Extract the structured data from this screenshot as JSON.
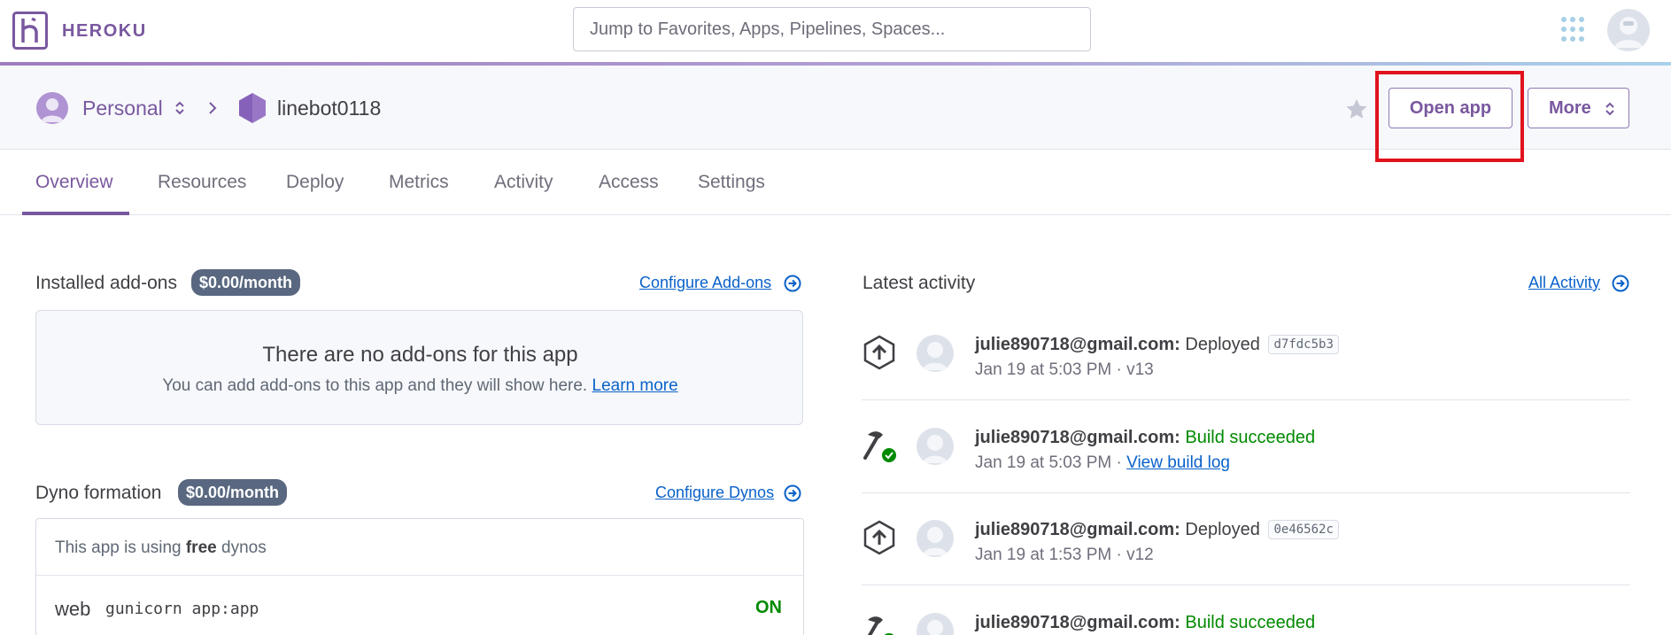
{
  "topbar": {
    "logo_text": "HEROKU",
    "search_placeholder": "Jump to Favorites, Apps, Pipelines, Spaces..."
  },
  "header": {
    "account_label": "Personal",
    "app_name": "linebot0118",
    "open_app_label": "Open app",
    "more_label": "More"
  },
  "tabs": [
    {
      "label": "Overview",
      "active": true
    },
    {
      "label": "Resources"
    },
    {
      "label": "Deploy"
    },
    {
      "label": "Metrics"
    },
    {
      "label": "Activity"
    },
    {
      "label": "Access"
    },
    {
      "label": "Settings"
    }
  ],
  "addons": {
    "title": "Installed add-ons",
    "price": "$0.00/month",
    "configure_link": "Configure Add-ons",
    "empty_title": "There are no add-ons for this app",
    "empty_text": "You can add add-ons to this app and they will show here.",
    "learn_more": "Learn more"
  },
  "dynos": {
    "title": "Dyno formation",
    "price": "$0.00/month",
    "configure_link": "Configure Dynos",
    "info_prefix": "This app is using",
    "info_bold": "free",
    "info_suffix": "dynos",
    "process_type": "web",
    "command": "gunicorn app:app",
    "state": "ON"
  },
  "activity": {
    "title": "Latest activity",
    "all_link": "All Activity",
    "items": [
      {
        "icon": "deploy-icon",
        "user": "julie890718@gmail.com:",
        "action": "Deployed",
        "commit": "d7fdc5b3",
        "meta": "Jan 19 at 5:03 PM · v13"
      },
      {
        "icon": "build-icon",
        "user": "julie890718@gmail.com:",
        "action": "Build succeeded",
        "meta": "Jan 19 at 5:03 PM ·",
        "link": "View build log"
      },
      {
        "icon": "deploy-icon",
        "user": "julie890718@gmail.com:",
        "action": "Deployed",
        "commit": "0e46562c",
        "meta": "Jan 19 at 1:53 PM · v12"
      },
      {
        "icon": "build-icon",
        "user": "julie890718@gmail.com:",
        "action": "Build succeeded"
      }
    ]
  },
  "colors": {
    "brand": "#79589f",
    "link": "#0a62c9",
    "success": "#008a00",
    "highlight": "#e0131d",
    "badge": "#596880"
  }
}
